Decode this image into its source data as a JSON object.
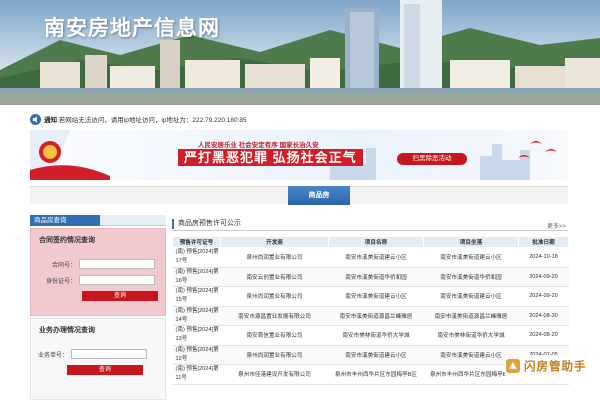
{
  "site": {
    "title": "南安房地产信息网"
  },
  "notice": {
    "lead": "通知",
    "text": ":若网站无法访问，请用ip地址访问，ip地址为：222.79.220.180:85"
  },
  "promo": {
    "subtitle": "人民安居乐业 社会安定有序 国家长治久安",
    "slogan": "严打黑恶犯罪 弘扬社会正气",
    "button": "扫黑除恶活动"
  },
  "section": {
    "tab": "商品房"
  },
  "sidebar": {
    "header": "商品房查询",
    "contract_panel": {
      "title": "合同签约情况查询",
      "fields": [
        {
          "label": "合同号：",
          "value": ""
        },
        {
          "label": "身份证号：",
          "value": ""
        }
      ],
      "button": "查询"
    },
    "business_panel": {
      "title": "业务办理情况查询",
      "fields": [
        {
          "label": "业务单号：",
          "value": ""
        }
      ],
      "button": "查询"
    }
  },
  "list": {
    "title": "商品房预售许可公示",
    "more": "更多>>",
    "columns": [
      "预售许可证号",
      "开发商",
      "项目名称",
      "项目坐落",
      "批准日期"
    ],
    "rows": [
      [
        "(南) 预售[2024]第17号",
        "泉州尚润置业有限公司",
        "南安市溪美街道建云小区",
        "南安市溪美街道建云小区",
        "2024-10-18"
      ],
      [
        "(南) 预售[2024]第16号",
        "南安云创置业有限公司",
        "南安市溪美街道华侨和园",
        "南安市溪美街道华侨和园",
        "2024-09-20"
      ],
      [
        "(南) 预售[2024]第15号",
        "泉州尚润置业有限公司",
        "南安市溪美街道建云小区",
        "南安市溪美街道建云小区",
        "2024-09-20"
      ],
      [
        "(南) 预售[2024]第14号",
        "南安市源昌置业发展有限公司",
        "南安市溪美街道源昌兰峰雅居",
        "南安市溪美街道源昌兰峰雅居",
        "2024-08-30"
      ],
      [
        "(南) 预售[2024]第13号",
        "南安首信置业有限公司",
        "南安市美林街道华侨大学城",
        "南安市美林街道华侨大学城",
        "2024-08-20"
      ],
      [
        "(南) 预售[2024]第12号",
        "泉州尚润置业有限公司",
        "南安市溪美街道建云小区",
        "南安市溪美街道建云小区",
        "2024-07-05"
      ],
      [
        "(南) 预售[2024]第11号",
        "泉州市佳港建设开发有限公司",
        "泉州市丰州西华片区东园梅亭B区",
        "泉州市丰州西华片区东园梅亭B区",
        "2024-06-14"
      ]
    ]
  },
  "watermark": {
    "text": "闪房管助手"
  },
  "colors": {
    "brand_blue": "#2f6fb3",
    "query_red": "#c8161e",
    "panel_pink": "#f2c9cf"
  }
}
